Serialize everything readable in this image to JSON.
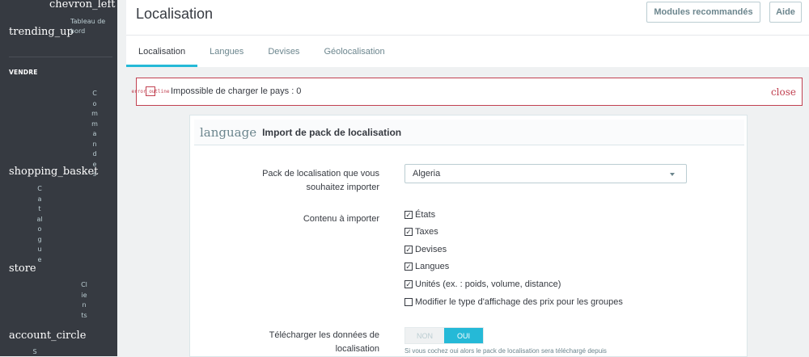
{
  "sidebar": {
    "collapse_icon": "chevron_left",
    "dashboard_icon": "trending_up",
    "dashboard_label": "Tableau de bord",
    "section_sell": "VENDRE",
    "items": [
      {
        "icon": "shopping_basket",
        "label": "Commandes"
      },
      {
        "icon": "store",
        "label": "Catalogue"
      },
      {
        "icon": "account_circle",
        "label": "Clients"
      }
    ],
    "partial_letter": "S"
  },
  "header": {
    "title": "Localisation",
    "recommended_modules": "Modules recommandés",
    "help": "Aide"
  },
  "tabs": [
    {
      "label": "Localisation",
      "active": true
    },
    {
      "label": "Langues",
      "active": false
    },
    {
      "label": "Devises",
      "active": false
    },
    {
      "label": "Géolocalisation",
      "active": false
    }
  ],
  "alert": {
    "icon": "error_outline",
    "message": "Impossible de charger le pays : 0",
    "close": "close"
  },
  "card": {
    "icon": "language",
    "title": "Import de pack de localisation",
    "pack_label": "Pack de localisation que vous souhaitez importer",
    "pack_value": "Algeria",
    "content_label": "Contenu à importer",
    "checkboxes": [
      {
        "label": "États",
        "checked": true
      },
      {
        "label": "Taxes",
        "checked": true
      },
      {
        "label": "Devises",
        "checked": true
      },
      {
        "label": "Langues",
        "checked": true
      },
      {
        "label": "Unités (ex. : poids, volume, distance)",
        "checked": true
      },
      {
        "label": "Modifier le type d'affichage des prix pour les groupes",
        "checked": false
      }
    ],
    "download_label": "Télécharger les données de localisation",
    "toggle_off": "NON",
    "toggle_on": "OUI",
    "download_help": "Si vous cochez oui alors le pack de localisation sera téléchargé depuis"
  },
  "colors": {
    "sidebar_bg": "#363a41",
    "accent": "#25b9d7",
    "danger": "#c14151"
  }
}
